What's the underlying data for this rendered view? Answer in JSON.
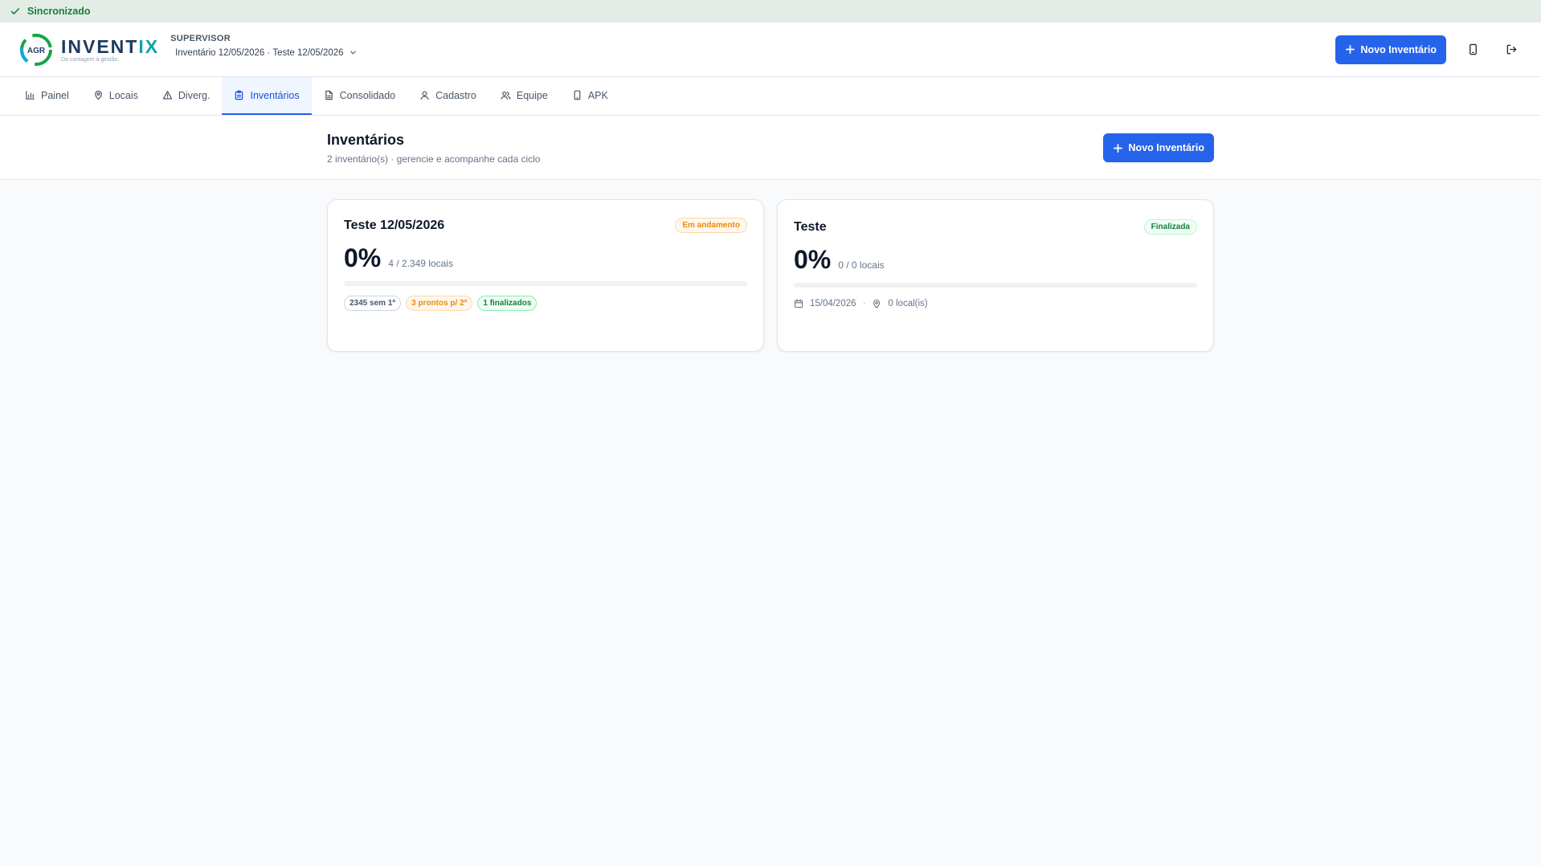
{
  "sync": {
    "label": "Sincronizado"
  },
  "header": {
    "logo_word": "INVENTIX",
    "logo_word_a": "INVENT",
    "logo_word_b": "IX",
    "logo_badge": "AGR",
    "logo_tagline": "Da contagem à gestão.",
    "role": "SUPERVISOR",
    "context": "Inventário 12/05/2026 · Teste 12/05/2026",
    "new_button": "Novo Inventário"
  },
  "tabs": [
    {
      "label": "Painel",
      "icon": "bar-chart-icon"
    },
    {
      "label": "Locais",
      "icon": "map-pin-icon"
    },
    {
      "label": "Diverg.",
      "icon": "warning-icon"
    },
    {
      "label": "Inventários",
      "icon": "clipboard-icon",
      "active": true
    },
    {
      "label": "Consolidado",
      "icon": "file-text-icon"
    },
    {
      "label": "Cadastro",
      "icon": "user-icon"
    },
    {
      "label": "Equipe",
      "icon": "users-icon"
    },
    {
      "label": "APK",
      "icon": "smartphone-icon"
    }
  ],
  "page": {
    "title": "Inventários",
    "subtitle": "2 inventário(s) · gerencie e acompanhe cada ciclo",
    "new_button": "Novo Inventário"
  },
  "cards": [
    {
      "name": "Teste 12/05/2026",
      "status": "Em andamento",
      "percent": "0%",
      "progress": 0,
      "locals": "4 / 2.349 locais",
      "pills": [
        "2345 sem 1ª",
        "3 prontos p/ 2ª",
        "1 finalizados"
      ]
    },
    {
      "name": "Teste",
      "status": "Finalizada",
      "percent": "0%",
      "progress": 0,
      "locals": "0 / 0 locais",
      "date": "15/04/2026",
      "local_count": "0 local(is)"
    }
  ],
  "colors": {
    "primary": "#2563eb",
    "sync_bg": "#e4ece6",
    "sync_text": "#15803d",
    "progress_orange": "#ea8a0c"
  }
}
